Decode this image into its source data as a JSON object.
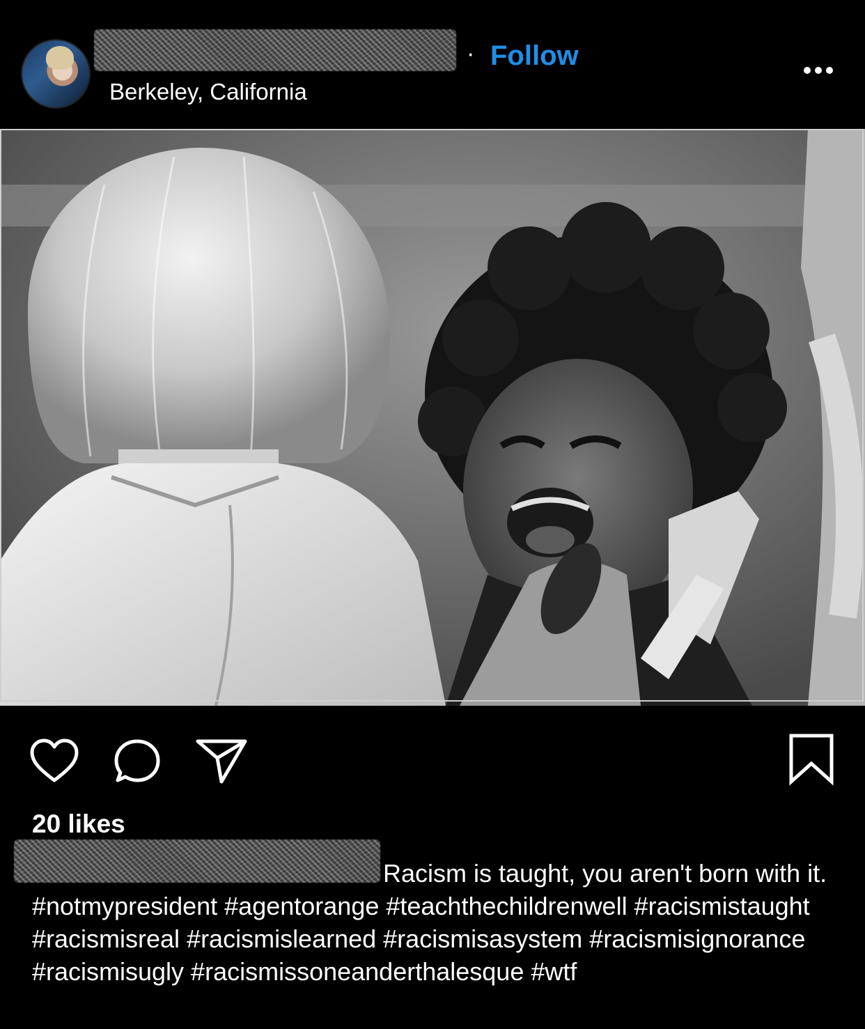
{
  "header": {
    "separator": "·",
    "follow_label": "Follow",
    "location": "Berkeley, California"
  },
  "post": {
    "likes": "20 likes",
    "caption": "Racism is taught, you aren't born with it. #notmypresident #agentorange #teachthechildrenwell #racismistaught #racismisreal #racismislearned #racismisasystem #racismisignorance #racismisugly #racismissoneanderthalesque #wtf"
  },
  "icons": {
    "like": "heart-icon",
    "comment": "comment-icon",
    "share": "paper-plane-icon",
    "save": "bookmark-icon",
    "more": "more-icon"
  },
  "colors": {
    "background": "#000000",
    "follow": "#1e8fe8",
    "text": "#ffffff"
  }
}
